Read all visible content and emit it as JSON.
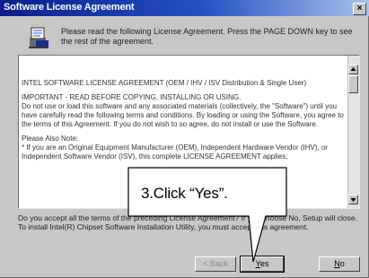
{
  "window": {
    "title": "Software License Agreement",
    "close_glyph": "×"
  },
  "intro": {
    "icon": "license-agreement-icon",
    "text": "Please read the following License Agreement. Press the PAGE DOWN key to see the rest of the agreement."
  },
  "license": {
    "heading": "INTEL SOFTWARE LICENSE AGREEMENT (OEM / IHV / ISV Distribution & Single User)",
    "important": "IMPORTANT - READ BEFORE COPYING, INSTALLING OR USING.",
    "body": "Do not use or load this software and any associated materials (collectively, the \"Software\") until you have carefully read the following terms and conditions. By loading or using the Software, you agree to the terms of this Agreement. If you do not wish to so agree, do not install or use the Software.",
    "note_label": "Please Also Note:",
    "note_body": "* If you are an Original Equipment Manufacturer (OEM), Independent Hardware Vendor (IHV), or Independent Software Vendor (ISV), this complete LICENSE AGREEMENT applies;"
  },
  "question": "Do you accept all the terms of the preceding License Agreement? If you choose No, Setup will close. To install Intel(R) Chipset Software Installation Utility, you must accept this agreement.",
  "buttons": {
    "back": "< Back",
    "yes_mnemonic": "Y",
    "yes_rest": "es",
    "no_mnemonic": "N",
    "no_rest": "o"
  },
  "callout": {
    "text": "3.Click “Yes”."
  }
}
